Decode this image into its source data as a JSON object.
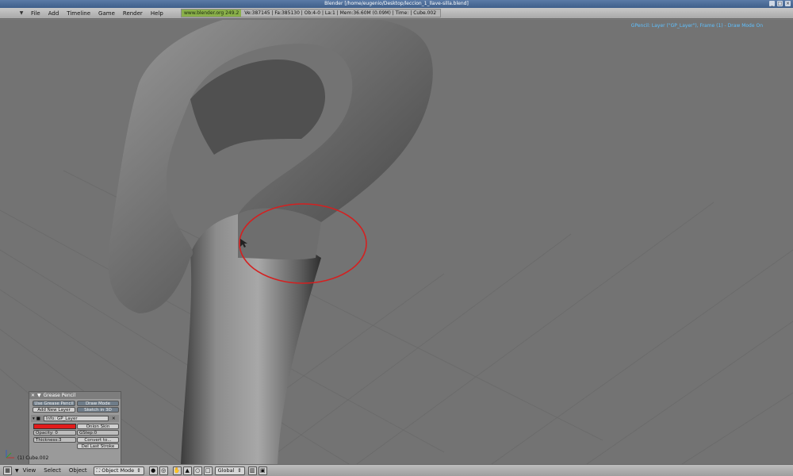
{
  "window": {
    "title": "Blender [/home/eugenio/Desktop/leccion_1_llave-silla.blend]"
  },
  "menubar": {
    "items": [
      "File",
      "Add",
      "Timeline",
      "Game",
      "Render",
      "Help"
    ],
    "site": "www.blender.org 249.2",
    "stats": "Ve:387145 | Fa:385130 | Ob:4-0 | La:1 | Mem:36.60M (0.09M) | Time: | Cube.002"
  },
  "viewport": {
    "gp_info": "GPencil: Layer (\"GP_Layer\"), Frame (1) - Draw Mode On",
    "object_label": "(1) Cube.002",
    "stroke_color": "#d42020",
    "background_color": "#737373"
  },
  "grease_panel": {
    "title": "Grease Pencil",
    "use_grease_pencil": "Use Grease Pencil",
    "draw_mode": "Draw Mode",
    "add_new_layer": "Add New Layer",
    "sketch_in_3d": "Sketch in 3D",
    "layer_name": "Info: GP_Layer",
    "onion_skin": "Onion Skin",
    "opacity": "Opacity: 0",
    "gstep": "GStep:0",
    "thickness": "Thickness:3",
    "convert_to": "Convert to...",
    "del_last_stroke": "Del Last Stroke",
    "layer_color": "#e21b1b"
  },
  "bottombar": {
    "items": [
      "View",
      "Select",
      "Object"
    ],
    "mode": "Object Mode",
    "orientation": "Global"
  }
}
